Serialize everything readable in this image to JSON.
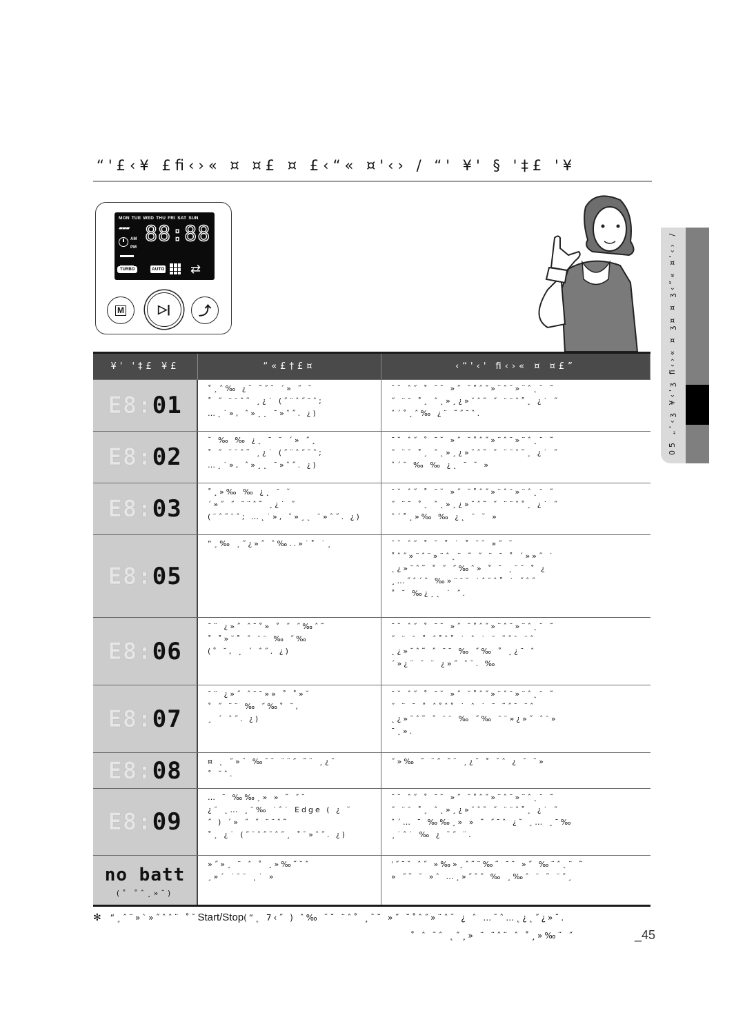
{
  "page": {
    "title": "“'£‹¥ £ﬁ‹›« ¤ ¤£ ¤ £‹“« ¤'‹› / “' ¥' § '‡£ '¥",
    "page_number": "_45"
  },
  "control_panel": {
    "days": [
      "MON",
      "TUE",
      "WED",
      "THU",
      "FRI",
      "SAT",
      "SUN"
    ],
    "clock_digits": "88:88",
    "am_label": "AM",
    "pm_label": "PM",
    "turbo_label": "TURBO",
    "auto_label": "AUTO",
    "buttons": [
      {
        "name": "mode",
        "glyph": "M"
      },
      {
        "name": "start-stop",
        "glyph": "▷|"
      },
      {
        "name": "recharge",
        "glyph": "⤴"
      }
    ]
  },
  "side_tab": {
    "label": "05 „'‹ʒ ¥‹'ʒ ﬁ‹›« ¤ ʒ¤ ¤ ʒ‹“« ¤'‹› /"
  },
  "table": {
    "headers": [
      "¥' '‡£ ¥£",
      "“«£†£¤",
      "‹“'‹' ﬁ‹›« ¤ ¤£”"
    ],
    "rows": [
      {
        "code_dim": "E8:",
        "code": "01",
        "code_sub": "",
        "cause": "˚¸ˆ‰ ¿¨ ˜˝ˉ ˊ» ˝ ˘\n˚ ˝ ¨¨ˆ˜ ¸¿˙ (˝¨ˆ˝ˉˆ;\n…˛˙», ˆ»¸˛ ˉ»ˆ˝. ¿)",
        "action": "ˉ˘ ˆ˝ ˚ ˉ˘ »˝ ˘˚ˆ˝»¨ˆ¨»¨ˆ˛¨ ˜\n˝ ¨ˉ ˚¸ ˆ˛»¸¿»˘ˆ˜ ˝ ¨¨ˆ˚¸ ¿˙ ˝\nˆˊ˚¸ˆ‰ ¿¨ ˜˝ˉˆ."
      },
      {
        "code_dim": "E8:",
        "code": "02",
        "code_sub": "",
        "cause": "˘ ‰ ‰ ¿˛ ˉ ˘ ˊ» ˝¸\n˚ ˝ ¨¨ˆ˜ ¸¿˙ (˝¨ˆ˝ˉˆ;\n…˛˙», ˆ»¸˛ ˉ»ˆ˝. ¿)",
        "action": "ˉ˘ ˆ˝ ˚ ˉ˘ »˝ ˘˚ˆ˝»¨ˆ¨»¨ˆ˛¨ ˜\n˝ ¨ˉ ˚¸ ˆ˛»¸¿»˘ˆ˜ ˝ ¨¨ˆ˜¸ ¿˙ ˝\nˆˊ˘ ‰ ‰ ¿˛ ˉ ˘ »"
      },
      {
        "code_dim": "E8:",
        "code": "03",
        "code_sub": "",
        "cause": "˚¸»‰ ‰ ¿˛ ˉ ˘\nˊ»˝ ˝ ¨¨ˆ˜ ¸¿˙ ˝\n(¨ˆ˝ˉˆ; …˛˙», ˆ»¸˛ ˉ»ˆ˝. ¿)",
        "action": "ˉ˘ ˆ˝ ˚ ˉ˘ »˝ ˘˚ˆ˝»¨ˆ¨»¨ˆ˛¨ ˜\n˝ ¨ˉ ˚¸ ˆ˛»¸¿»˘ˆ˜ ˝ ¨¨ˆ˚¸ ¿˙ ˝\nˆˊ˚¸»‰ ‰ ¿˛ ˉ ˘ »"
      },
      {
        "code_dim": "E8:",
        "code": "05",
        "code_sub": "",
        "cause": "“¸‰ ¸˝¿»˝ ˆ‰..»˙˚ ˙¸",
        "action": "ˉ˘ ˆ˝ ˚ ˘ ˚ ˙ ˚ ˉ˘ »˝ ˘\n˚ˆ˝»¨ˆ¨»¨ˆ˛¨ ˜ ˝ ¨ ˉ ˚ ˊ»»˝ ˙\n˛¿»˘ˆ˜ ˚ ˝ ˝‰ˆ» ˚ ˘ ˛¨¨ ˚ ¿\n¸…˝ˆˊˆ ‰»¨ˉ˘ ˙ˆ˘ˆ˚ ˙ ˝ˆ˝\n˚ ˘ ‰¿¸˛ ˙ ˝."
      },
      {
        "code_dim": "E8:",
        "code": "06",
        "code_sub": "",
        "cause": "ˉ¨ ¿»˝ ˆˉ˚» ˚ ˝ ˝‰ˆ˜\n˚ ˚»˘˚ ˝ ¨¨ ‰ ˝‰\n(˚ ˘, ¸ ˊ ˆ˝. ¿)",
        "action": "ˉ˘ ˆ˝ ˚ ˉ˘ »˝ ˘˚ˆ˝»¨ˆ¨»¨ˆ˛¨ ˜\n˝ ¨ ˉ ˚ ˆ˚ˆ˚ ˙ ˆ ˙ ˉ ˜˝ˉ ¨ˆ\n˛¿»˘ˆ˜ ˝ ¨¨ ‰ ˝‰ ˚ ¸¿¨ ˆ\nˊ»¿¨ ˉ ¨ ¿»˝ ˆˉ. ‰"
      },
      {
        "code_dim": "E8:",
        "code": "07",
        "code_sub": "",
        "cause": "ˉ¨ ¿»˝ ˆˉˉ»» ˚ ˚»˘\n˚ ˝ ¨¨ ‰ ˝‰˚ ˘,\n¸ ˊ ˆ˝. ¿)",
        "action": "ˉ˘ ˆ˝ ˚ ˉ˘ »˝ ˘˚ˆ˝»¨ˆ¨»¨ˆ˛¨ ˜\n˝ ¨ ˉ ˚ ˆ˚ˆ˚ ˙ ˆ ˙ ˉ ˜˝ˉ ¨ˆ\n˛¿»˘ˆ˜ ˝ ¨¨ ‰ ˝‰ ˉ¨»¿»˝ ˆˉ»\nˉ¸»."
      },
      {
        "code_dim": "E8:",
        "code": "08",
        "code_sub": "",
        "cause": "¤ ˛ ˝»¨ ‰˘ˉ ¨¨˝ ˜¨ ¸¿˘\n˚ ˘ˆ.",
        "action": "˝»‰ ˜ ¨˝ ˜¨ ¸¿˘ ˚ ˘ˆ ¿ ˘ ˉ»"
      },
      {
        "code_dim": "E8:",
        "code": "09",
        "code_sub": "",
        "cause": "… ˉ ‰‰¸» » ˜ ˝ˉ\n¿˘ ˛… ¸ˉ‰ ˙ˆ˙ Edge ( ¿ ˘\n˝ ) ˊ» ˝ ˝ ¨¨ˆ˜\n˚¸ ¿˙ (˝¨ˆ˝ˉˆ˝¸ ˚ˉ»ˆ˝. ¿)",
        "action": "ˉ˘ ˆ˝ ˚ ˉ˘ »˝ ˘˚ˆ˝»¨ˆ¨»¨ˆ˛¨ ˜\n˝ ¨ˉ ˚¸ ˆ˛»¸¿»˘ˆ˜ ˝ ¨¨ˆ˚¸ ¿˙ ˝\nˆˊ… ˉ ‰‰¸» » ˜ ˝ˉˆ ¿˘ ˛… ¸ˉ‰\n¸˙ˆ˙ ‰ ¿ ˘˝ ¨."
      },
      {
        "code_dim": "",
        "code": "no batt",
        "code_sub": "(˚ ˚ˆ¸»˘)",
        "cause": "»˝»¸ ¨ ˆ ˚ ¸»‰˜˘ˆ\n¸»ˊ ˙ˉ¨ ˛˙ »",
        "action": "ˈ˝ˉ˘ ˆ˝ »‰»¸ˆ˜¨‰˜ ˉ˘ »˝ ‰¨ˆ˛¨ ˜\n» ˝˜ ˘ »ˆ …¸»˝ˆ˝ ‰ ¸‰ˆ ¨ ˜ ¨˝¸"
      }
    ]
  },
  "footnote": {
    "star": "✻",
    "before": "“¸ˆ¨»ˋ»˝ˆˆ¨ ˚ˉ",
    "english": "Start/Stop",
    "after": "(“˛ 7‹˝ ) ˆ‰ ˉ˘ ¨ˆ˚ ¸ˉ˘ »˝ ˘˚ˆ˝»¨ˆˉ ¿ ˆ …ˉˆ…˛¿˛˝¿»˘.",
    "line2": "˚ ˆ ˉˆ ˛˝¸» ¨ ¨ˆ¨ ˆ ˚¸»‰¨ ˝"
  }
}
